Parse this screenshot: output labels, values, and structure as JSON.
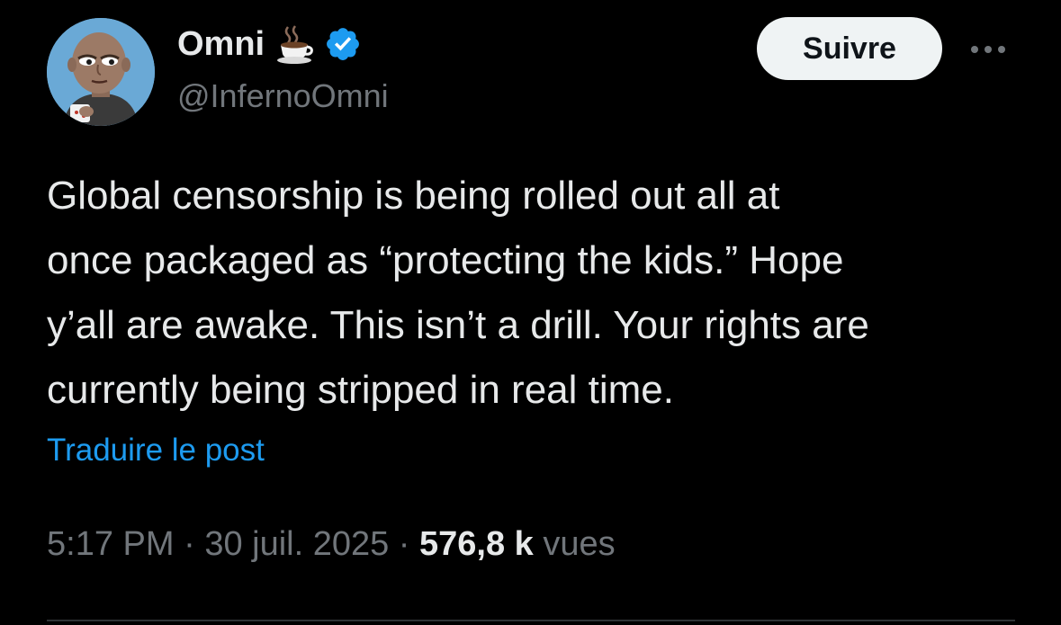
{
  "author": {
    "display_name": "Omni",
    "handle": "@InfernoOmni",
    "avatar_icon": "cartoon-bald-man-with-coffee-avatar",
    "name_emoji_icon": "hot-coffee-icon",
    "verified_icon": "verified-badge-icon",
    "verified_color": "#1d9bf0"
  },
  "actions": {
    "follow_label": "Suivre",
    "more_icon": "more-horizontal-icon"
  },
  "post": {
    "text_lines": [
      "Global censorship is being rolled out all at",
      "once packaged as “protecting the kids.” Hope",
      "y’all are awake. This isn’t a drill. Your rights are",
      "currently being stripped in real time."
    ],
    "translate_label": "Traduire le post"
  },
  "meta": {
    "time": "5:17 PM",
    "separator": " · ",
    "date": "30 juil. 2025",
    "views_count": "576,8 k",
    "views_label": "vues"
  },
  "colors": {
    "background": "#000000",
    "primary_text": "#e7e9ea",
    "secondary_text": "#71767b",
    "link": "#1d9bf0",
    "follow_bg": "#eff3f4"
  }
}
